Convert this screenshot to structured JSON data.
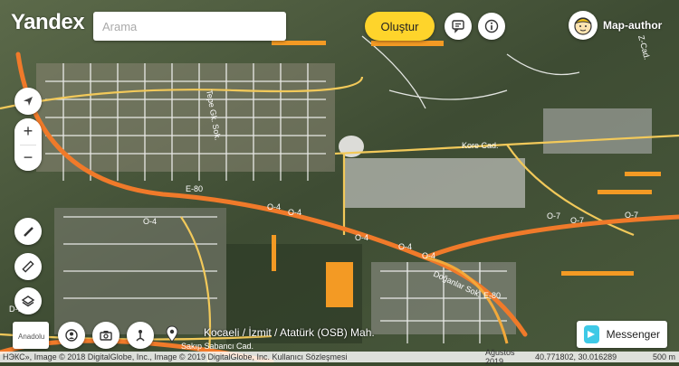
{
  "app": {
    "logo": "Yandex"
  },
  "search": {
    "placeholder": "Arama",
    "value": ""
  },
  "header": {
    "create_label": "Oluştur",
    "feedback_icon": "speech-bubble-icon",
    "info_icon": "info-icon"
  },
  "user": {
    "name": "Map-author"
  },
  "left_controls": {
    "locate_icon": "location-arrow-icon",
    "zoom_in": "+",
    "zoom_out": "−",
    "tools": [
      "ruler-icon",
      "ruler-icon",
      "layers-icon"
    ]
  },
  "bottom_controls": {
    "thumbnail_label": "Anadolu",
    "icons": [
      "panorama-person-icon",
      "camera-icon",
      "route-icon",
      "pin-icon"
    ]
  },
  "location": {
    "text": "Kocaeli / İzmit / Atatürk (OSB) Mah."
  },
  "messenger": {
    "label": "Messenger"
  },
  "footer": {
    "copyright": "НЭКС», Image © 2018 DigitalGlobe, Inc., Image © 2019 DigitalGlobe, Inc. Kullanıcı Sözleşmesi",
    "date": "Ağustos 2019",
    "coordinates": "40.771802, 30.016289",
    "scale": "500 m"
  },
  "map_labels": [
    {
      "text": "E-80"
    },
    {
      "text": "O-4"
    },
    {
      "text": "O-4"
    },
    {
      "text": "O-4"
    },
    {
      "text": "O-4"
    },
    {
      "text": "O-4"
    },
    {
      "text": "O-4"
    },
    {
      "text": "O-7"
    },
    {
      "text": "O-7"
    },
    {
      "text": "O-7"
    },
    {
      "text": "E-80"
    },
    {
      "text": "Kore Cad."
    },
    {
      "text": "Tepe Gk. Sok."
    },
    {
      "text": "Doğanlar Sok."
    },
    {
      "text": "D-100"
    },
    {
      "text": "Sakıp Sabancı Cad."
    },
    {
      "text": "Z-Cad."
    }
  ],
  "colors": {
    "accent": "#fed42b",
    "motorway": "#f07a2a",
    "road": "#f2c95a",
    "street": "#ffffff",
    "terrain": "#3b4a2e"
  }
}
